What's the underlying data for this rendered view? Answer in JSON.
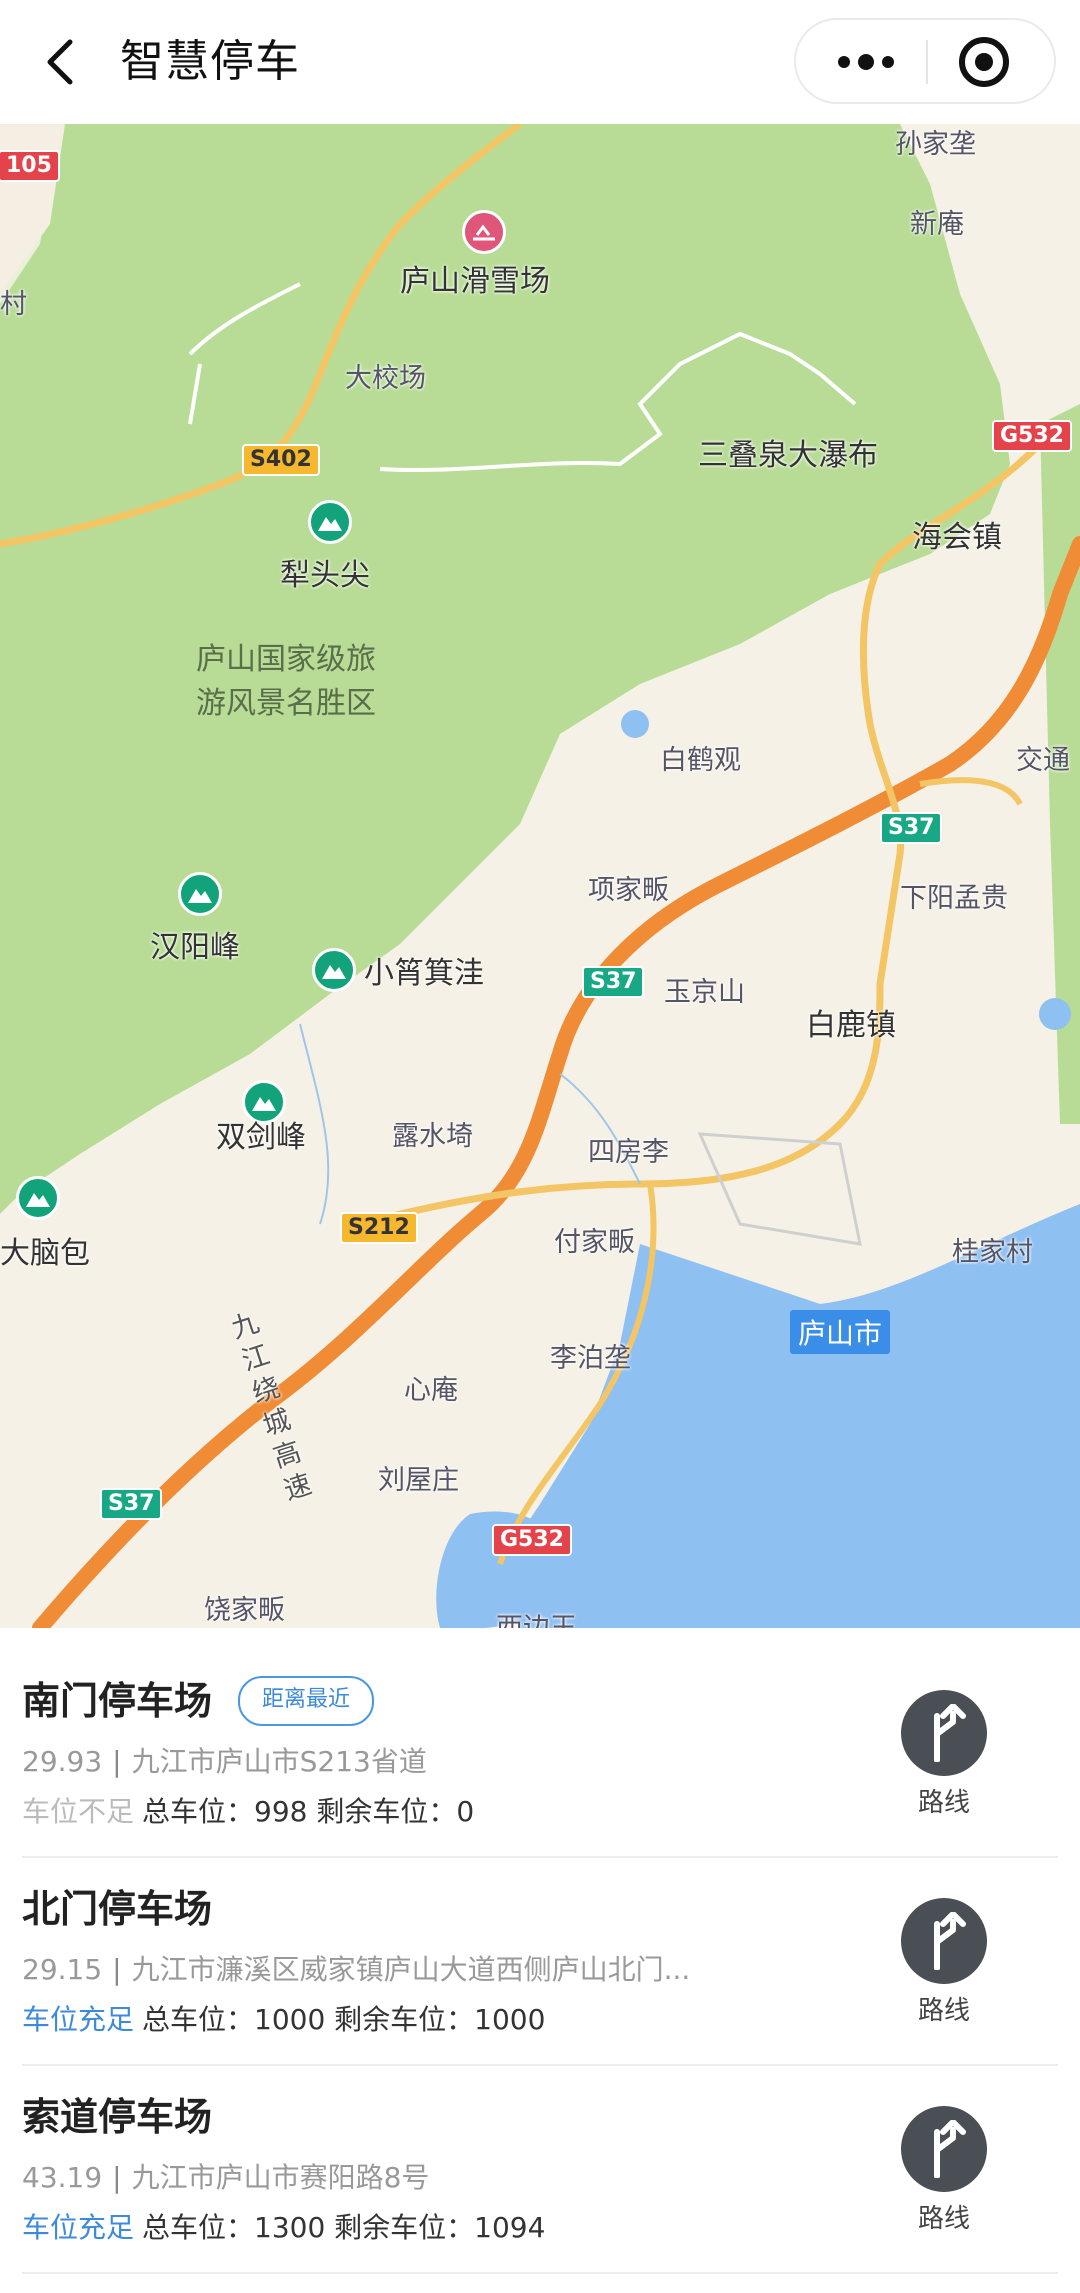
{
  "header": {
    "title": "智慧停车"
  },
  "map": {
    "places": [
      {
        "id": "sunjiawa",
        "text": "孙家垄"
      },
      {
        "id": "xinan",
        "text": "新庵"
      },
      {
        "id": "cun",
        "text": "村"
      },
      {
        "id": "lushan-ski",
        "text": "庐山滑雪场"
      },
      {
        "id": "dajiaochang",
        "text": "大校场"
      },
      {
        "id": "sandiequan",
        "text": "三叠泉大瀑布"
      },
      {
        "id": "haihui",
        "text": "海会镇"
      },
      {
        "id": "litoujian",
        "text": "犁头尖"
      },
      {
        "id": "scenic-1",
        "text": "庐山国家级旅"
      },
      {
        "id": "scenic-2",
        "text": "游风景名胜区"
      },
      {
        "id": "baiheguan",
        "text": "白鹤观"
      },
      {
        "id": "jiaotong",
        "text": "交通"
      },
      {
        "id": "xiangjiafan",
        "text": "项家畈"
      },
      {
        "id": "xiayangmengmeng",
        "text": "下阳孟贵"
      },
      {
        "id": "hanyangfeng",
        "text": "汉阳峰"
      },
      {
        "id": "xiaojiwa",
        "text": "小筲箕洼"
      },
      {
        "id": "yujingshan",
        "text": "玉京山"
      },
      {
        "id": "bailuzhen",
        "text": "白鹿镇"
      },
      {
        "id": "shuangjianfeng",
        "text": "双剑峰"
      },
      {
        "id": "lushuiqi",
        "text": "露水埼"
      },
      {
        "id": "sifangli",
        "text": "四房李"
      },
      {
        "id": "danaobao",
        "text": "大脑包"
      },
      {
        "id": "fujiafan",
        "text": "付家畈"
      },
      {
        "id": "guijiacun",
        "text": "桂家村"
      },
      {
        "id": "libowa",
        "text": "李泊垄"
      },
      {
        "id": "xinan2",
        "text": "心庵"
      },
      {
        "id": "liuwuzhuang",
        "text": "刘屋庄"
      },
      {
        "id": "raojiafan",
        "text": "饶家畈"
      },
      {
        "id": "xibian",
        "text": "西边王"
      },
      {
        "id": "jiujiang-ring",
        "text": "九江绕城高速"
      }
    ],
    "shields": {
      "r105": "105",
      "g532a": "G532",
      "s402": "S402",
      "s37a": "S37",
      "s37b": "S37",
      "s212": "S212",
      "s37c": "S37",
      "g532b": "G532"
    },
    "city": "庐山市"
  },
  "parking": [
    {
      "name": "南门停车场",
      "tag": "距离最近",
      "distance": "29.93",
      "address": "九江市庐山市S213省道",
      "status": "车位不足",
      "stats": "总车位：998 剩余车位：0",
      "route": "路线"
    },
    {
      "name": "北门停车场",
      "distance": "29.15",
      "address": "九江市濂溪区威家镇庐山大道西侧庐山北门...",
      "status": "车位充足",
      "stats": "总车位：1000 剩余车位：1000",
      "route": "路线"
    },
    {
      "name": "索道停车场",
      "distance": "43.19",
      "address": "九江市庐山市赛阳路8号",
      "status": "车位充足",
      "stats": "总车位：1300 剩余车位：1094",
      "route": "路线"
    }
  ],
  "colors": {
    "forest": "#b8dc96",
    "water": "#8fc0f2",
    "expressway": "#f08c35",
    "accent": "#3d8ad8",
    "route_button": "#4a4f55"
  }
}
